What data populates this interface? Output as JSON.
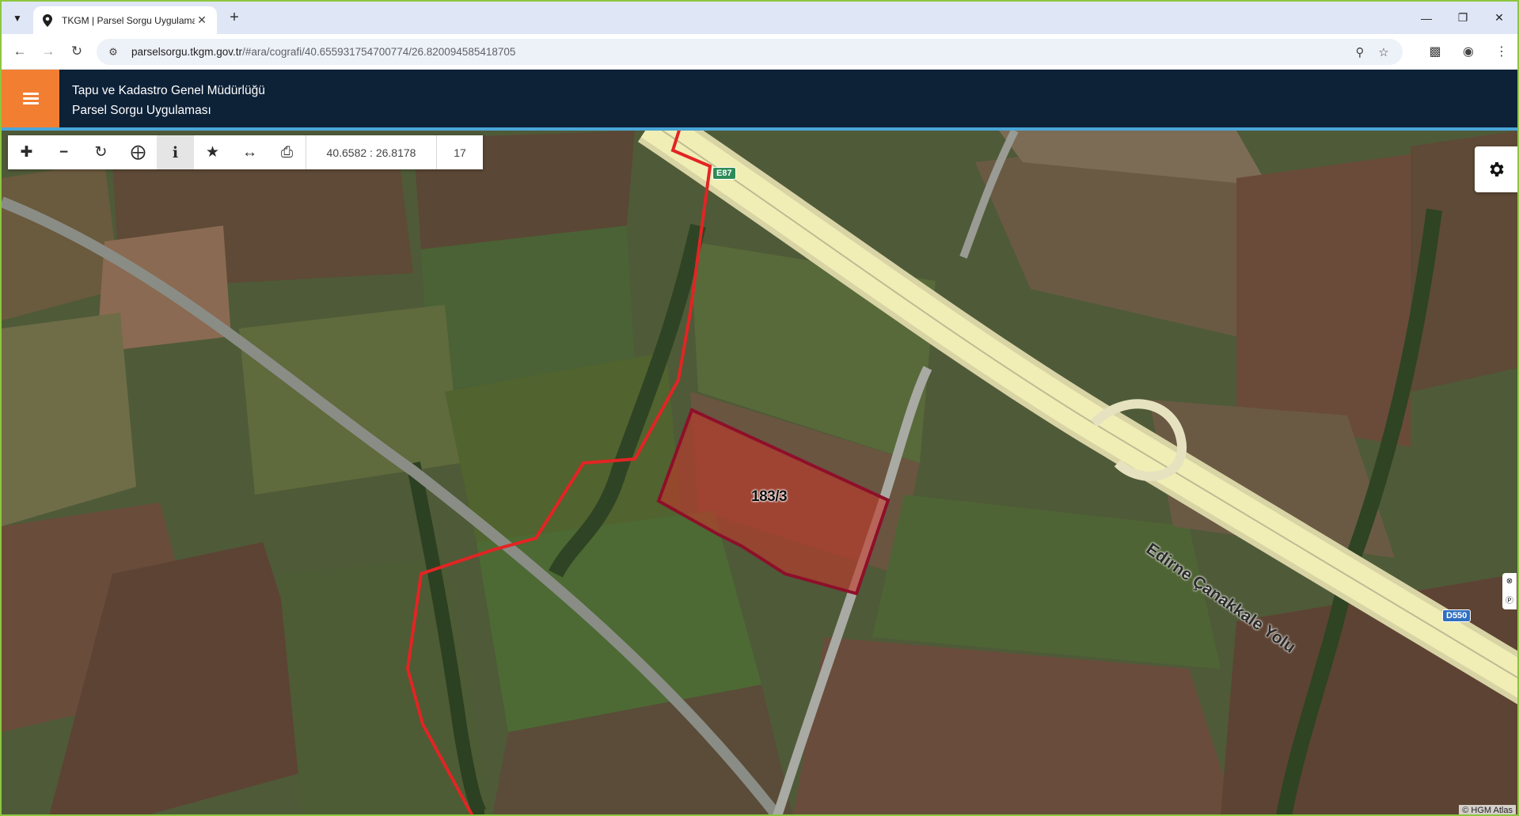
{
  "browser": {
    "tab_title": "TKGM | Parsel Sorgu Uygulaması",
    "url_host": "parselsorgu.tkgm.gov.tr",
    "url_path": "/#ara/cografi/40.655931754700774/26.820094585418705"
  },
  "header": {
    "org_name": "Tapu ve Kadastro Genel Müdürlüğü",
    "app_name": "Parsel Sorgu Uygulaması"
  },
  "map_toolbar": {
    "coordinates": "40.6582 : 26.8178",
    "zoom_level": "17",
    "tools": [
      "zoom-in",
      "zoom-out",
      "refresh",
      "locate",
      "info",
      "favorite",
      "measure",
      "print"
    ]
  },
  "map": {
    "parcel_label": "183/3",
    "road_name": "Edirne Çanakkale Yolu",
    "route_shields": [
      "E87",
      "D550"
    ],
    "attribution": "© HGM Atlas",
    "colors": {
      "parcel_fill": "#c0392b",
      "parcel_outline": "#8e0f2a",
      "boundary_line": "#e32424",
      "highway": "#f0eeb5"
    }
  },
  "colors": {
    "header_bg": "#0d2137",
    "menu_button": "#f27e32",
    "header_stripe": "#4aa6d8"
  }
}
